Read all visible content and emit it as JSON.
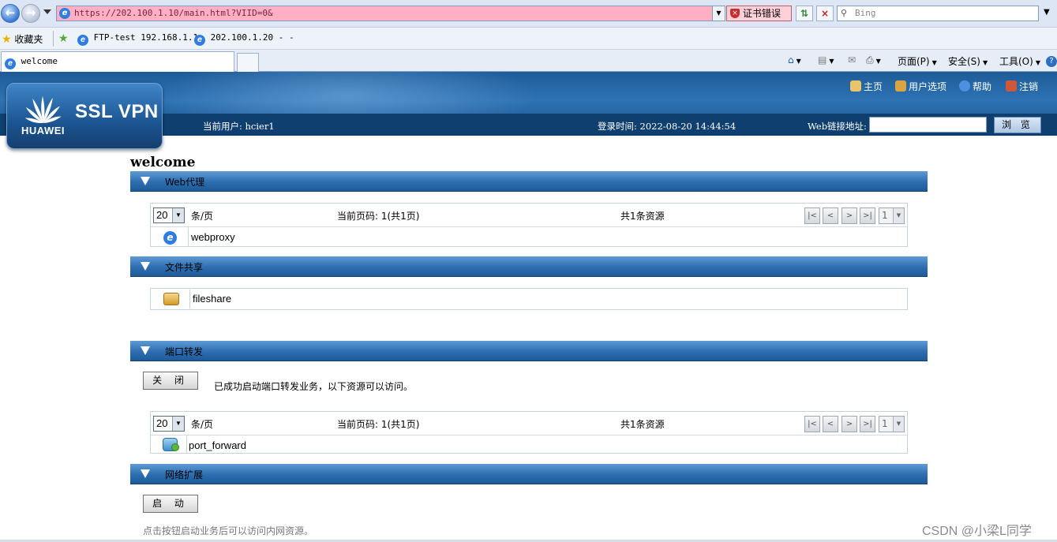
{
  "browser": {
    "url": "https://202.100.1.10/main.html?VIID=0&",
    "cert_error": "证书错误",
    "search_placeholder": "Bing",
    "favorites_label": "收藏夹",
    "bookmarks": [
      "FTP-test 192.168.1.1",
      "202.100.1.20 - -"
    ],
    "tab_title": "welcome",
    "commands": {
      "page": "页面(P)",
      "safety": "安全(S)",
      "tools": "工具(O)"
    }
  },
  "header": {
    "logo_text": "SSL VPN",
    "brand": "HUAWEI",
    "links": {
      "home": "主页",
      "user_options": "用户选项",
      "help": "帮助",
      "logout": "注销"
    },
    "current_user": "当前用户: hcier1",
    "login_time": "登录时间: 2022-08-20  14:44:54",
    "web_link_label": "Web链接地址:",
    "web_link_value": "",
    "browse_button": "浏 览"
  },
  "page": {
    "title": "welcome",
    "sections": {
      "web_proxy": {
        "title": "Web代理",
        "pager": {
          "page_size": "20",
          "per_page_label": "条/页",
          "current_page": "当前页码: 1(共1页)",
          "total": "共1条资源",
          "page_select": "1",
          "first": "|<",
          "prev": "<",
          "next": ">",
          "last": ">|"
        },
        "resources": [
          "webproxy"
        ]
      },
      "file_share": {
        "title": "文件共享",
        "resources": [
          "fileshare"
        ]
      },
      "port_forward": {
        "title": "端口转发",
        "close_button": "关 闭",
        "message": "已成功启动端口转发业务，以下资源可以访问。",
        "pager": {
          "page_size": "20",
          "per_page_label": "条/页",
          "current_page": "当前页码: 1(共1页)",
          "total": "共1条资源",
          "page_select": "1",
          "first": "|<",
          "prev": "<",
          "next": ">",
          "last": ">|"
        },
        "resources": [
          "port_forward"
        ]
      },
      "network_extension": {
        "title": "网络扩展",
        "start_button": "启 动",
        "message": "点击按钮启动业务后可以访问内网资源。"
      }
    }
  },
  "watermark": "CSDN @小梁L同学"
}
